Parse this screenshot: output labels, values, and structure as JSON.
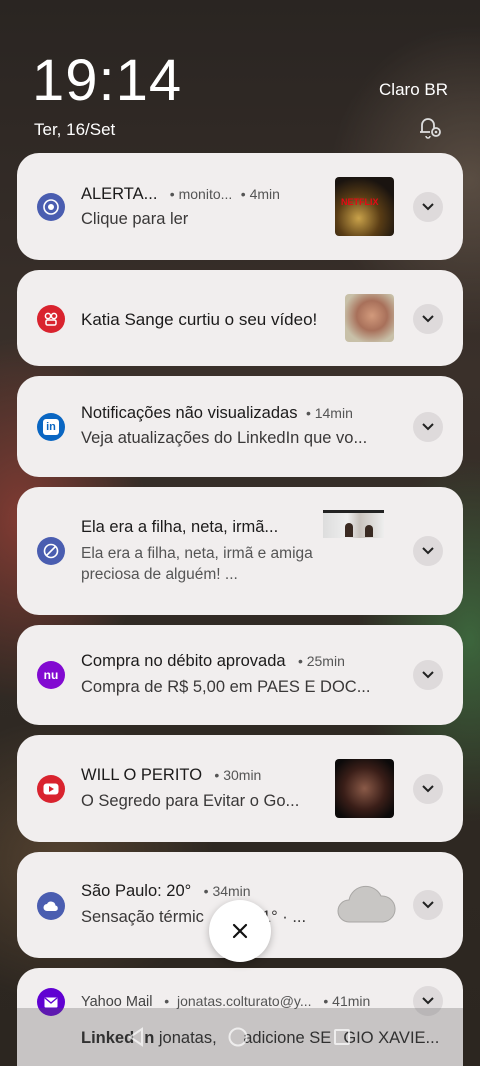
{
  "status": {
    "time": "19:14",
    "date": "Ter, 16/Set",
    "carrier": "Claro BR"
  },
  "notifications": [
    {
      "app_icon": "chrome-icon",
      "title": "ALERTA...",
      "source": "monito...",
      "time": "4min",
      "body": "Clique para ler",
      "thumbnail": "netflix-thumbnail",
      "accent": "#4a5db0"
    },
    {
      "app_icon": "kwai-icon",
      "title": "Katia Sange curtiu o seu vídeo!",
      "thumbnail": "face-thumbnail",
      "accent": "#d9232e"
    },
    {
      "app_icon": "linkedin-icon",
      "title": "Notificações não visualizadas",
      "time": "14min",
      "body": "Veja atualizações do LinkedIn que vo...",
      "accent": "#0a66c2"
    },
    {
      "app_icon": "browser-icon",
      "title": "Ela era a filha, neta, irmã...",
      "body": "Ela era a filha, neta, irmã e amiga preciosa de alguém! ...",
      "thumbnail": "news-thumbnail",
      "accent": "#4a5db0"
    },
    {
      "app_icon": "nubank-icon",
      "title": "Compra no débito aprovada",
      "time": "25min",
      "body": "Compra de R$ 5,00 em PAES E DOC...",
      "accent": "#820ad1"
    },
    {
      "app_icon": "youtube-icon",
      "title": "WILL O PERITO",
      "time": "30min",
      "body": "O Segredo para Evitar o Go...",
      "thumbnail": "video-thumbnail",
      "accent": "#d9232e"
    },
    {
      "app_icon": "weather-icon",
      "title": "São Paulo: 20°",
      "time": "34min",
      "body": "Sensação térmic",
      "body_tail": "1° · ...",
      "thumbnail": "cloud-icon",
      "accent": "#4a5db0"
    },
    {
      "app_icon": "yahoo-mail-icon",
      "title": "Yahoo Mail",
      "source": "jonatas.colturato@y...",
      "time": "41min",
      "body_bold": "Linked",
      "body_bold2": "n",
      "body": "jonatas, ",
      "body_mid": "adicione SE",
      "body_end": "GIO XAVIE...",
      "accent": "#6001d2"
    }
  ],
  "thumb_texts": {
    "netflix": "NETFLIX"
  },
  "separator": "•"
}
